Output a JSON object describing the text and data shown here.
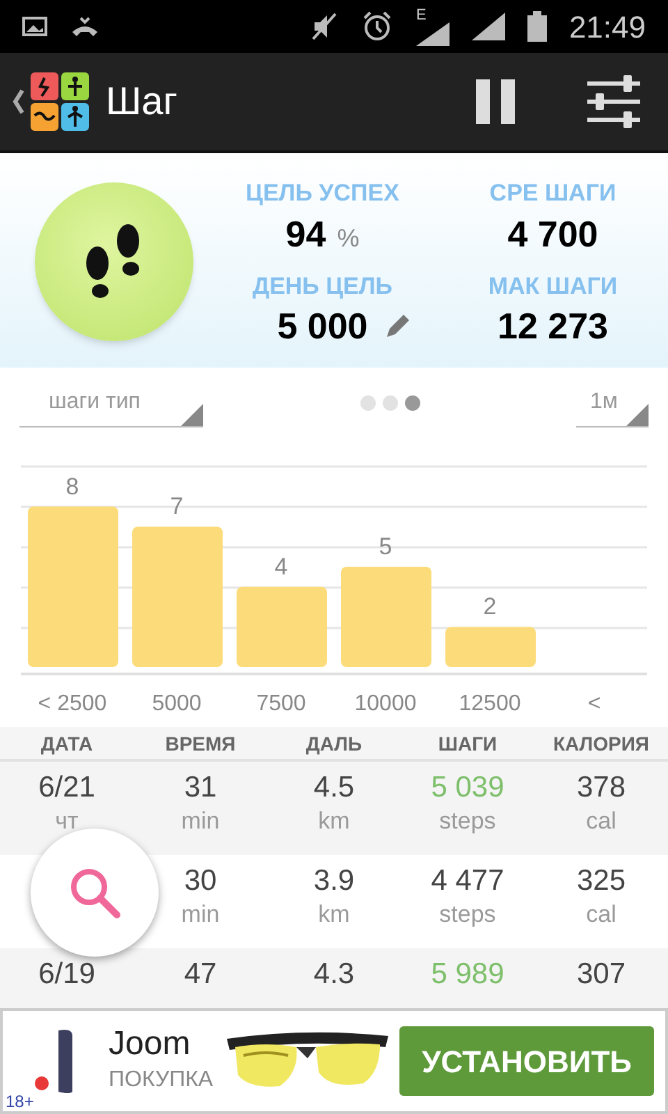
{
  "status_bar": {
    "network": "E",
    "time": "21:49"
  },
  "app_bar": {
    "title": "Шаг"
  },
  "summary": {
    "stats": [
      {
        "label": "ЦЕЛЬ УСПЕХ",
        "value": "94",
        "unit": "%",
        "editable": false
      },
      {
        "label": "СРЕ ШАГИ",
        "value": "4 700",
        "editable": false
      },
      {
        "label": "ДЕНЬ ЦЕЛЬ",
        "value": "5 000",
        "editable": true
      },
      {
        "label": "МАК ШАГИ",
        "value": "12 273",
        "editable": false
      }
    ]
  },
  "filters": {
    "type_dropdown": "шаги тип",
    "period_dropdown": "1м"
  },
  "pages": [
    {
      "selected": false
    },
    {
      "selected": false
    },
    {
      "selected": true
    }
  ],
  "chart_data": {
    "type": "bar",
    "categories": [
      "< 2500",
      "5000",
      "7500",
      "10000",
      "12500",
      "<"
    ],
    "series": [
      {
        "color": "#fcdc7a",
        "values": [
          8,
          7,
          4,
          5,
          2,
          null
        ]
      }
    ],
    "data_labels": true
  },
  "table": {
    "columns": [
      "ДАТА",
      "ВРЕМЯ",
      "ДАЛЬ",
      "ШАГИ",
      "КАЛОРИЯ"
    ],
    "rows": [
      {
        "goal_met": true,
        "cells": [
          {
            "value": "6/21",
            "unit": "чт"
          },
          {
            "value": "31",
            "unit": "min"
          },
          {
            "value": "4.5",
            "unit": "km"
          },
          {
            "value": "5 039",
            "unit": "steps"
          },
          {
            "value": "378",
            "unit": "cal"
          }
        ]
      },
      {
        "goal_met": false,
        "cells": [
          null,
          {
            "value": "30",
            "unit": "min"
          },
          {
            "value": "3.9",
            "unit": "km"
          },
          {
            "value": "4 477",
            "unit": "steps"
          },
          {
            "value": "325",
            "unit": "cal"
          }
        ]
      },
      {
        "goal_met": true,
        "cells": [
          {
            "value": "6/19"
          },
          {
            "value": "47"
          },
          {
            "value": "4.3"
          },
          {
            "value": "5 989"
          },
          {
            "value": "307"
          }
        ]
      }
    ]
  },
  "ad": {
    "brand": "Joom",
    "subtitle": "ПОКУПКА",
    "button": "УСТАНОВИТЬ",
    "age": "18+"
  }
}
